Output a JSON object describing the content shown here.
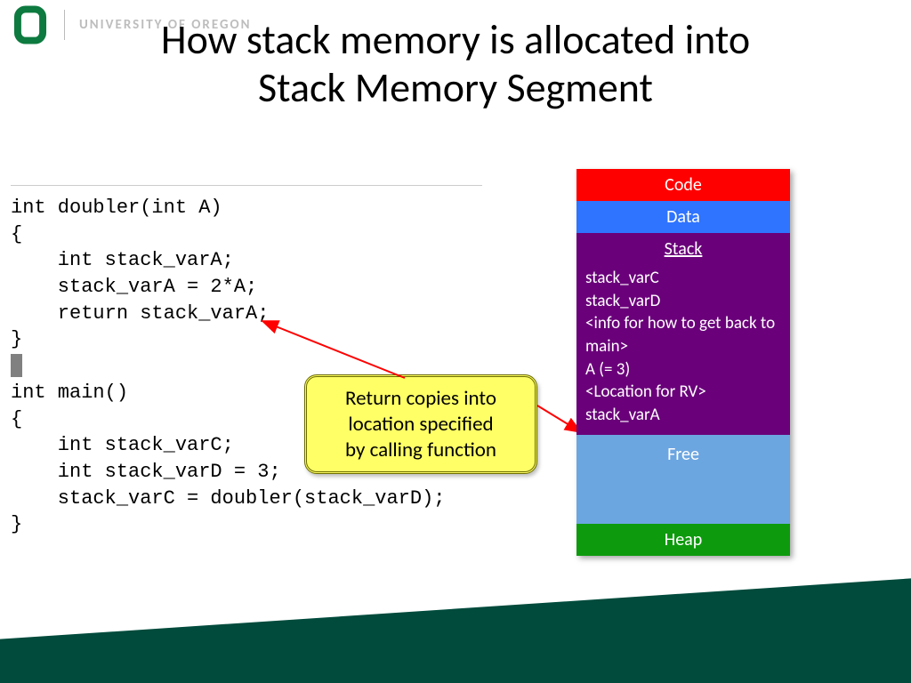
{
  "header": {
    "university": "UNIVERSITY OF OREGON",
    "logo_color": "#0d7a3f"
  },
  "title_line1": "How stack memory is allocated into",
  "title_line2": "Stack Memory Segment",
  "code": {
    "l1": "int doubler(int A)",
    "l2": "{",
    "l3": "    int stack_varA;",
    "l4": "    stack_varA = 2*A;",
    "l5": "    return stack_varA;",
    "l6": "}",
    "l7": "",
    "l8": "int main()",
    "l9": "{",
    "l10": "    int stack_varC;",
    "l11": "    int stack_varD = 3;",
    "l12": "    stack_varC = doubler(stack_varD);",
    "l13": "}"
  },
  "callout": {
    "line1": "Return copies into",
    "line2": "location specified",
    "line3": "by calling function"
  },
  "memory": {
    "code": "Code",
    "data": "Data",
    "stack_header": "Stack",
    "stack_items": [
      "stack_varC",
      "stack_varD",
      "<info for how to get back to main>",
      "A (= 3)",
      "<Location for RV>",
      "stack_varA"
    ],
    "free": "Free",
    "heap": "Heap"
  },
  "colors": {
    "code": "#ff0000",
    "data": "#2f74ff",
    "stack": "#6a007a",
    "free": "#6ca6e0",
    "heap": "#0d9b0d",
    "footer": "#004b3c"
  }
}
